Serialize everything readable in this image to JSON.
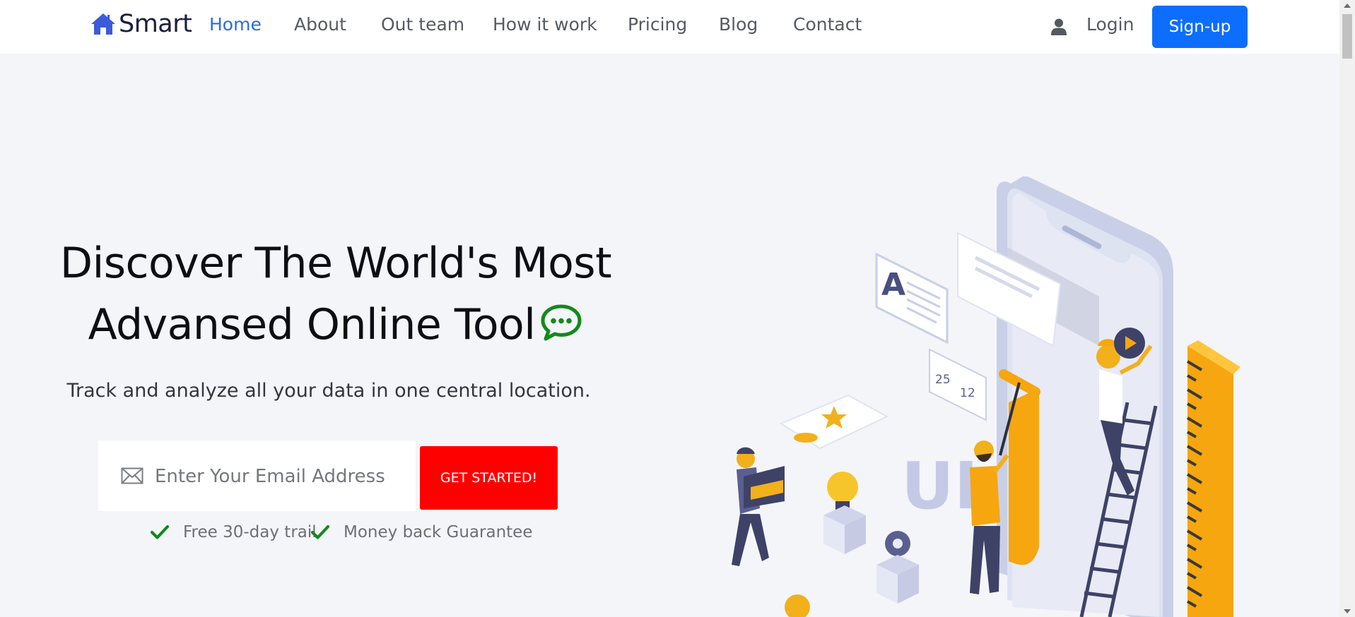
{
  "nav": {
    "brand": "Smart",
    "links": [
      {
        "label": "Home",
        "active": true
      },
      {
        "label": "About"
      },
      {
        "label": "Out team"
      },
      {
        "label": "How it work"
      },
      {
        "label": "Pricing"
      },
      {
        "label": "Blog"
      },
      {
        "label": "Contact"
      }
    ],
    "login": "Login",
    "signup": "Sign-up",
    "icons": {
      "brand": "house-icon",
      "user": "user-icon"
    }
  },
  "hero": {
    "title_line1": "Discover The World's Most",
    "title_line2": "Advansed Online Tool",
    "title_icon": "chat-bubble-icon",
    "subtitle": "Track and analyze all your data in one central location.",
    "email_placeholder": "Enter Your Email Address",
    "email_value": "",
    "cta": "GET STARTED!",
    "features": [
      "Free 30-day trail",
      "Money back Guarantee"
    ],
    "illustration_labels": {
      "likes": "25",
      "comments": "12",
      "letter": "A",
      "ui_text": "UI"
    }
  },
  "colors": {
    "brand": "#1b1f3b",
    "nav_active": "#2a6be6",
    "signup": "#0d6efd",
    "cta": "#ff0000",
    "check": "#138a1c",
    "chat_icon": "#138a1c",
    "background": "#f4f5f9"
  }
}
